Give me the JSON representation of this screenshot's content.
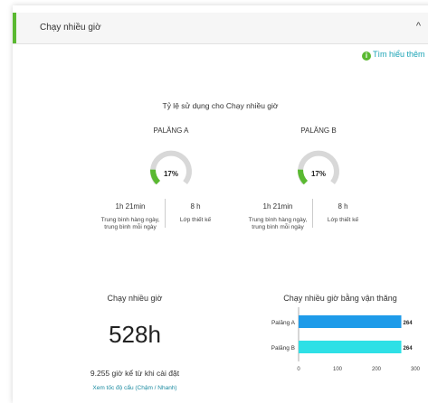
{
  "header": {
    "title": "Chạy nhiều giờ",
    "chevron": "^"
  },
  "learn_more": {
    "label": "Tìm hiểu thêm",
    "icon": "info-icon"
  },
  "usage": {
    "title": "Tỷ lệ sử dụng cho Chạy nhiều giờ",
    "hoists": [
      {
        "name": "PALĂNG A",
        "percent_label": "17%",
        "percent": 17,
        "avg_value": "1h 21min",
        "avg_label": "Trung bình hàng ngày, trung bình mỗi ngày",
        "design_value": "8 h",
        "design_label": "Lớp thiết kế"
      },
      {
        "name": "PALĂNG B",
        "percent_label": "17%",
        "percent": 17,
        "avg_value": "1h 21min",
        "avg_label": "Trung bình hàng ngày, trung bình mỗi ngày",
        "design_value": "8 h",
        "design_label": "Lớp thiết kế"
      }
    ]
  },
  "run_hours": {
    "title": "Chạy nhiều giờ",
    "value": "528h",
    "since_install": "9.255 giờ kể từ khi cài đặt",
    "speed_link": "Xem tốc độ cẩu (Chậm / Nhanh)"
  },
  "colors": {
    "accent": "#5ab931",
    "gauge_track": "#d8d8d8",
    "bar_a": "#1e9be9",
    "bar_b": "#2ee0e6",
    "link": "#1aa3b5"
  },
  "chart_data": {
    "type": "bar",
    "orientation": "horizontal",
    "title": "Chạy nhiều giờ bằng vận thăng",
    "categories": [
      "Palăng A",
      "Palăng B"
    ],
    "values": [
      264,
      264
    ],
    "value_labels": [
      "264",
      "264"
    ],
    "xlim": [
      0,
      300
    ],
    "xticks": [
      "0",
      "100",
      "200",
      "300"
    ]
  }
}
